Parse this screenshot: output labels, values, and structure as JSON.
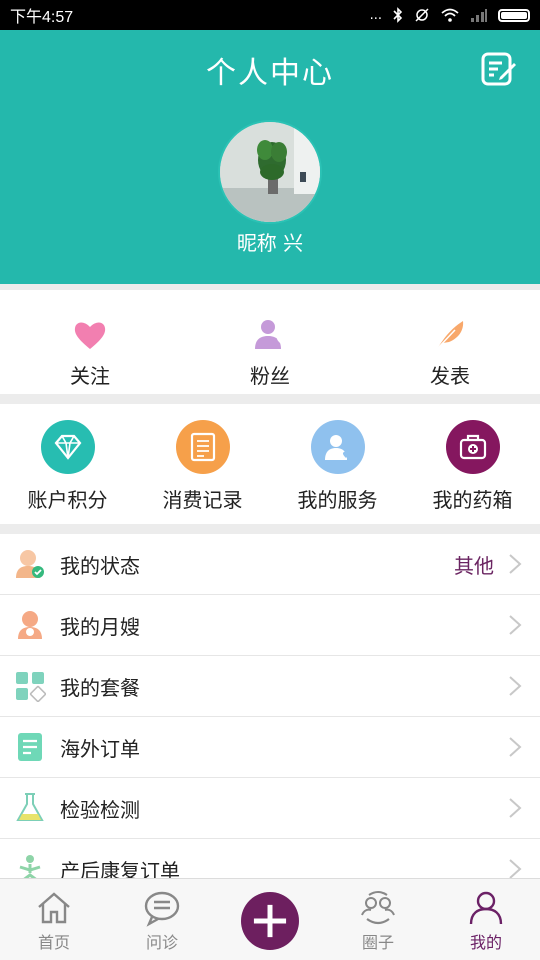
{
  "status_bar": {
    "time": "下午4:57",
    "signal_dots": "..."
  },
  "header": {
    "title": "个人中心",
    "nickname": "昵称 兴"
  },
  "social": [
    {
      "label": "关注",
      "icon": "heart-icon"
    },
    {
      "label": "粉丝",
      "icon": "fans-icon"
    },
    {
      "label": "发表",
      "icon": "feather-icon"
    }
  ],
  "quick": [
    {
      "label": "账户积分",
      "icon": "diamond-icon",
      "color": "#27bdb1"
    },
    {
      "label": "消费记录",
      "icon": "receipt-icon",
      "color": "#f6a04a"
    },
    {
      "label": "我的服务",
      "icon": "service-user-icon",
      "color": "#8fc1ee"
    },
    {
      "label": "我的药箱",
      "icon": "medicine-box-icon",
      "color": "#85175f"
    }
  ],
  "menu": [
    {
      "label": "我的状态",
      "value": "其他",
      "icon": "status-person-icon"
    },
    {
      "label": "我的月嫂",
      "value": "",
      "icon": "nanny-icon"
    },
    {
      "label": "我的套餐",
      "value": "",
      "icon": "package-grid-icon"
    },
    {
      "label": "海外订单",
      "value": "",
      "icon": "overseas-order-icon"
    },
    {
      "label": "检验检测",
      "value": "",
      "icon": "flask-icon"
    },
    {
      "label": "产后康复订单",
      "value": "",
      "icon": "yoga-icon"
    }
  ],
  "tabs": [
    {
      "label": "首页",
      "icon": "home-icon",
      "active": false
    },
    {
      "label": "问诊",
      "icon": "chat-icon",
      "active": false
    },
    {
      "label": "",
      "icon": "plus-icon",
      "active": false
    },
    {
      "label": "圈子",
      "icon": "circle-icon",
      "active": false
    },
    {
      "label": "我的",
      "icon": "profile-icon",
      "active": true
    }
  ],
  "colors": {
    "primary": "#24b8ac",
    "accent": "#6d1f5f"
  }
}
